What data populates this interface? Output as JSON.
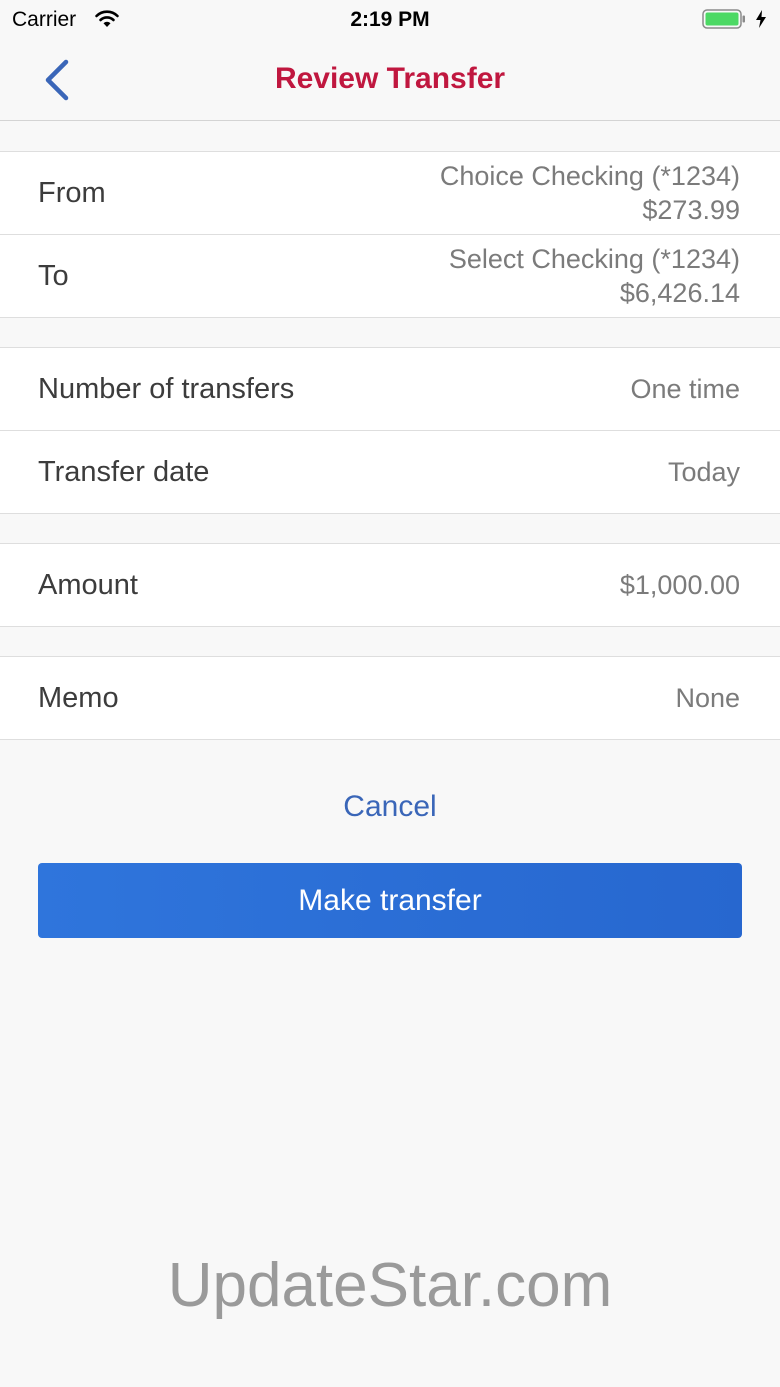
{
  "status_bar": {
    "carrier": "Carrier",
    "time": "2:19 PM",
    "icons": [
      "wifi-icon",
      "battery-icon",
      "charging-bolt-icon"
    ]
  },
  "nav": {
    "title": "Review Transfer",
    "back_icon": "chevron-left-icon"
  },
  "accounts": {
    "from": {
      "label": "From",
      "account": "Choice Checking (*1234)",
      "balance": "$273.99"
    },
    "to": {
      "label": "To",
      "account": "Select Checking (*1234)",
      "balance": "$6,426.14"
    }
  },
  "schedule": {
    "number": {
      "label": "Number of transfers",
      "value": "One time"
    },
    "date": {
      "label": "Transfer date",
      "value": "Today"
    }
  },
  "amount": {
    "label": "Amount",
    "value": "$1,000.00"
  },
  "memo": {
    "label": "Memo",
    "value": "None"
  },
  "actions": {
    "cancel": "Cancel",
    "submit": "Make transfer"
  },
  "watermark": "UpdateStar.com",
  "colors": {
    "title": "#c0173f",
    "link": "#3a66b8",
    "button": "#2a6dd6",
    "battery": "#4cd964"
  }
}
